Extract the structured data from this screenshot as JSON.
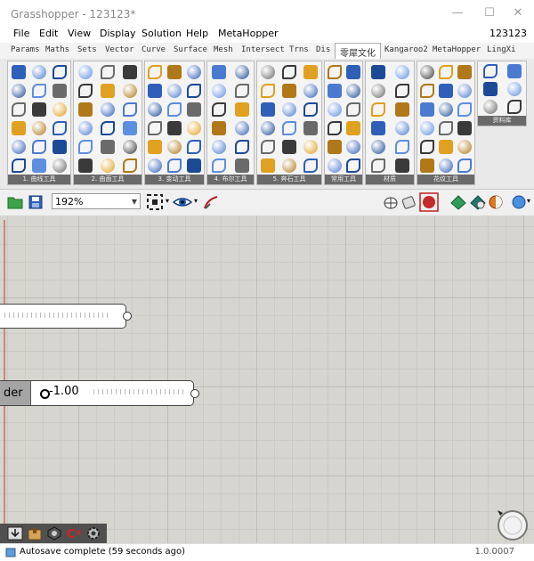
{
  "window": {
    "title": "Grasshopper - 123123*",
    "minimize_glyph": "—",
    "maximize_glyph": "☐",
    "close_glyph": "✕"
  },
  "menubar": {
    "items": [
      "File",
      "Edit",
      "View",
      "Display",
      "Solution",
      "Help",
      "MetaHopper"
    ],
    "right_text": "123123"
  },
  "tabs": [
    "Params",
    "Maths",
    "Sets",
    "Vector",
    "Curve",
    "Surface",
    "Mesh",
    "Intersect",
    "Trns",
    "Dis",
    "零犀文化",
    "Kangaroo2",
    "MetaHopper",
    "LingXi"
  ],
  "active_tab": "零犀文化",
  "ribbon": {
    "panels": [
      {
        "label": "1. 曲线工具"
      },
      {
        "label": "2. 曲面工具"
      },
      {
        "label": "3. 变动工具"
      },
      {
        "label": "4. 布尔工具"
      },
      {
        "label": "5. 奔石工具"
      },
      {
        "label": "常用工具"
      },
      {
        "label": "材质"
      },
      {
        "label": "花纹工具"
      },
      {
        "label": "资料库"
      }
    ]
  },
  "toolbar": {
    "zoom": "192%",
    "icons": [
      "open-file-icon",
      "save-icon",
      "zoom-extents-icon",
      "eye-icon",
      "sketch-icon",
      "preview-wireframe-icon",
      "preview-shaded-icon",
      "preview-selected-icon",
      "material-icon",
      "document-preview-icon",
      "sphere-icon"
    ]
  },
  "canvas": {
    "slider1": {
      "value": ""
    },
    "slider2": {
      "label": "der",
      "value": "-1.00"
    }
  },
  "bottom_toolbar": {
    "icons": [
      "download-icon",
      "pack-icon",
      "nut-icon",
      "c-sharp-icon",
      "gear-icon"
    ]
  },
  "status": {
    "message": "Autosave complete (59 seconds ago)",
    "version": "1.0.0007"
  },
  "colors": {
    "canvas": "#d6d5cf",
    "ribbon": "#e9e9e9",
    "panel_label": "#6a6a6a",
    "accent_blue": "#2f5fb8"
  }
}
